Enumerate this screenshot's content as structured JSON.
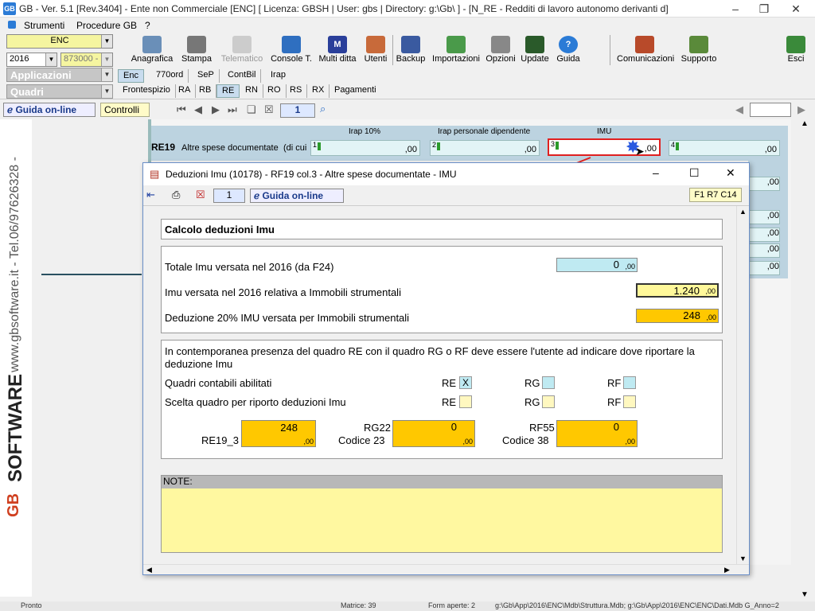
{
  "window": {
    "title": "GB - Ver. 5.1 [Rev.3404] -  Ente non Commerciale [ENC]     [ Licenza: GBSH | User: gbs | Directory: g:\\Gb\\ ] - [N_RE - Redditi di lavoro autonomo derivanti d]",
    "minimize": "–",
    "restore": "❐",
    "close": "✕"
  },
  "menu": {
    "strumenti": "Strumenti",
    "procedure": "Procedure GB",
    "help": "?"
  },
  "combos": {
    "entity": "ENC",
    "year": "2016",
    "code": "873000 -"
  },
  "nav": {
    "applicazioni": "Applicazioni",
    "quadri": "Quadri"
  },
  "toolbar": {
    "anagrafica": "Anagrafica",
    "stampa": "Stampa",
    "telematico": "Telematico",
    "console": "Console T.",
    "multiditta": "Multi ditta",
    "utenti": "Utenti",
    "backup": "Backup",
    "importazioni": "Importazioni",
    "opzioni": "Opzioni",
    "update": "Update",
    "guida": "Guida",
    "comunicazioni": "Comunicazioni",
    "supporto": "Supporto",
    "esci": "Esci"
  },
  "tabs1": [
    "Enc",
    "770ord",
    "SeP",
    "ContBil",
    "Irap"
  ],
  "tabs2": [
    "Frontespizio",
    "RA",
    "RB",
    "RE",
    "RN",
    "RO",
    "RS",
    "RX",
    "Pagamenti"
  ],
  "guida_online": "Guida on-line",
  "controlli": "Controlli",
  "page_num": "1",
  "re19": {
    "code": "RE19",
    "label": "Altre spese documentate",
    "dicui": "(di cui",
    "h1": "Irap 10%",
    "h2": "Irap personale dipendente",
    "h3": "IMU",
    "f1n": "1",
    "f2n": "2",
    "f3n": "3",
    "f4n": "4",
    "f1": ",00",
    "f2": ",00",
    "f3": ",00",
    "f4": ",00"
  },
  "right_cells": [
    ",00",
    ",00",
    ",00",
    ",00",
    ",00"
  ],
  "sidebar": {
    "phone": "www.gbsoftware.it - Tel.06/97626328 -",
    "brand": "SOFTWARE",
    "logo": "GB"
  },
  "dialog": {
    "title": "Deduzioni Imu (10178) - RF19 col.3 - Altre spese documentate - IMU",
    "page": "1",
    "guida": "Guida on-line",
    "ref": "F1 R7 C14",
    "section_title": "Calcolo deduzioni Imu",
    "totale_label": "Totale Imu versata nel 2016 (da F24)",
    "totale_val": "0",
    "totale_c": ",00",
    "strum_label": "Imu versata nel 2016 relativa a Immobili strumentali",
    "strum_val": "1.240",
    "strum_c": ",00",
    "ded_label": "Deduzione 20% IMU versata per Immobili strumentali",
    "ded_val": "248",
    "ded_c": ",00",
    "info": "In contemporanea presenza del quadro RE con il quadro RG o RF deve essere l'utente ad indicare dove riportare la deduzione Imu",
    "quadri_label": "Quadri contabili abilitati",
    "scelta_label": "Scelta quadro per riporto deduzioni Imu",
    "re": "RE",
    "rg": "RG",
    "rf": "RF",
    "re_x": "X",
    "re19_3": "RE19_3",
    "re19_val": "248",
    "re19_c": ",00",
    "rg22": "RG22",
    "cod23": "Codice 23",
    "rg22_val": "0",
    "rg22_c": ",00",
    "rf55": "RF55",
    "cod38": "Codice 38",
    "rf55_val": "0",
    "rf55_c": ",00",
    "note": "NOTE:"
  },
  "status": {
    "left": "Pronto",
    "matrice": "Matrice: 39",
    "form": "Form aperte: 2",
    "path": "g:\\Gb\\App\\2016\\ENC\\Mdb\\Struttura.Mdb; g:\\Gb\\App\\2016\\ENC\\ENC\\Dati.Mdb G_Anno=2"
  }
}
